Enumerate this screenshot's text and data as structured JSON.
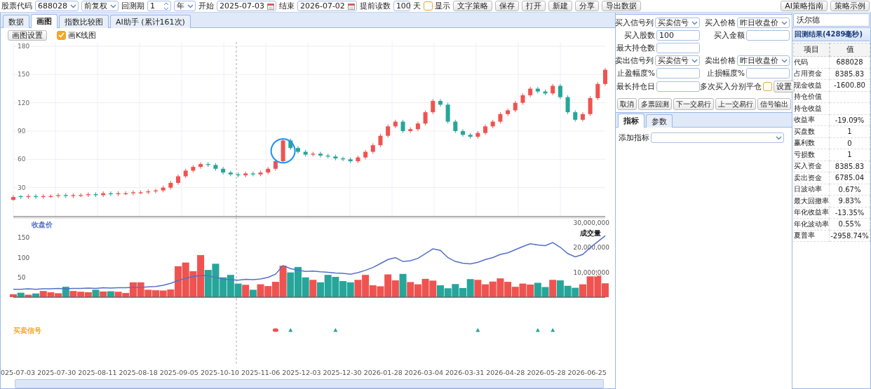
{
  "toolbar": {
    "items": [
      {
        "kind": "label",
        "text": "股票代码"
      },
      {
        "kind": "select",
        "value": "688028"
      },
      {
        "kind": "select",
        "value": "前复权"
      },
      {
        "kind": "label",
        "text": "回测期"
      },
      {
        "kind": "spinner",
        "value": "1"
      },
      {
        "kind": "select",
        "value": "年"
      },
      {
        "kind": "label",
        "text": "开始"
      },
      {
        "kind": "date",
        "value": "2025-07-03"
      },
      {
        "kind": "label",
        "text": "结束"
      },
      {
        "kind": "date",
        "value": "2026-07-02"
      },
      {
        "kind": "label",
        "text": "提前读数"
      },
      {
        "kind": "input",
        "value": "100"
      },
      {
        "kind": "label",
        "text": "天"
      },
      {
        "kind": "checkbox",
        "label": "显示",
        "checked": false
      },
      {
        "kind": "button",
        "label": "文字策略"
      },
      {
        "kind": "button",
        "label": "保存"
      },
      {
        "kind": "button",
        "label": "打开"
      },
      {
        "kind": "button",
        "label": "新建"
      },
      {
        "kind": "button",
        "label": "分享"
      },
      {
        "kind": "button",
        "label": "导出数据"
      }
    ],
    "right_buttons": [
      "AI策略指南",
      "策略示例"
    ]
  },
  "left": {
    "tabs": [
      {
        "label": "数据",
        "selected": false
      },
      {
        "label": "画图",
        "selected": true
      },
      {
        "label": "指数比较图",
        "selected": false
      },
      {
        "label": "AI助手 (累计161次)",
        "selected": false
      }
    ],
    "settings_button": "画图设置",
    "kline_checkbox": {
      "label": "画K线图",
      "checked": true
    },
    "price_chart": {
      "chart_data": {
        "type": "candlestick",
        "grid": true,
        "ylim": [
          0,
          180
        ],
        "yticks": [
          30,
          60,
          90,
          120,
          150,
          180
        ],
        "categories": [
          null,
          null,
          null,
          null,
          null,
          null,
          null,
          null,
          null,
          null,
          null,
          null,
          null,
          null,
          null,
          null,
          null,
          null,
          null,
          null,
          null,
          null,
          null,
          null,
          null,
          null,
          null,
          null,
          null,
          null,
          null,
          null,
          null,
          null,
          null,
          null,
          null,
          null,
          null,
          null,
          null,
          null,
          null,
          null,
          null,
          null,
          null,
          null,
          null,
          null,
          null,
          null,
          null,
          null,
          null,
          null,
          null,
          null,
          null,
          null,
          null,
          null,
          null,
          null,
          null,
          null,
          null,
          null,
          null,
          null,
          null,
          null,
          null,
          null,
          null,
          null,
          null,
          null,
          null,
          null
        ],
        "ohlc": [
          [
            17,
            22,
            16,
            20
          ],
          [
            21,
            22,
            18,
            20
          ],
          [
            20,
            23,
            18,
            21
          ],
          [
            21,
            23,
            18,
            20
          ],
          [
            20,
            23,
            18,
            21
          ],
          [
            20,
            23,
            19,
            21
          ],
          [
            21,
            24,
            19,
            22
          ],
          [
            22,
            24,
            19,
            21
          ],
          [
            21,
            24,
            19,
            22
          ],
          [
            21,
            24,
            20,
            22
          ],
          [
            22,
            25,
            20,
            23
          ],
          [
            23,
            25,
            20,
            22
          ],
          [
            22,
            26,
            20,
            24
          ],
          [
            24,
            26,
            21,
            23
          ],
          [
            23,
            26,
            21,
            24
          ],
          [
            23,
            26,
            22,
            24
          ],
          [
            24,
            27,
            22,
            25
          ],
          [
            24,
            27,
            23,
            25
          ],
          [
            25,
            28,
            23,
            26
          ],
          [
            26,
            29,
            24,
            27
          ],
          [
            27,
            32,
            25,
            30
          ],
          [
            30,
            37,
            28,
            35
          ],
          [
            35,
            44,
            33,
            42
          ],
          [
            42,
            50,
            40,
            48
          ],
          [
            48,
            54,
            46,
            52
          ],
          [
            52,
            57,
            50,
            55
          ],
          [
            55,
            57,
            52,
            54
          ],
          [
            54,
            56,
            48,
            50
          ],
          [
            50,
            52,
            44,
            46
          ],
          [
            46,
            48,
            42,
            44
          ],
          [
            44,
            46,
            41,
            43
          ],
          [
            43,
            47,
            41,
            45
          ],
          [
            45,
            47,
            42,
            44
          ],
          [
            44,
            48,
            42,
            46
          ],
          [
            46,
            52,
            44,
            50
          ],
          [
            50,
            60,
            48,
            58
          ],
          [
            58,
            82,
            56,
            80
          ],
          [
            80,
            82,
            70,
            72
          ],
          [
            72,
            74,
            66,
            68
          ],
          [
            68,
            70,
            63,
            65
          ],
          [
            65,
            68,
            63,
            66
          ],
          [
            66,
            68,
            62,
            64
          ],
          [
            64,
            66,
            61,
            63
          ],
          [
            63,
            65,
            59,
            61
          ],
          [
            61,
            63,
            58,
            60
          ],
          [
            60,
            62,
            56,
            58
          ],
          [
            58,
            64,
            56,
            62
          ],
          [
            62,
            70,
            60,
            68
          ],
          [
            68,
            77,
            66,
            75
          ],
          [
            75,
            87,
            73,
            85
          ],
          [
            85,
            97,
            83,
            95
          ],
          [
            95,
            102,
            93,
            100
          ],
          [
            100,
            102,
            88,
            90
          ],
          [
            90,
            94,
            88,
            92
          ],
          [
            92,
            100,
            90,
            98
          ],
          [
            98,
            112,
            96,
            110
          ],
          [
            110,
            124,
            108,
            122
          ],
          [
            122,
            124,
            116,
            118
          ],
          [
            118,
            120,
            98,
            100
          ],
          [
            100,
            102,
            88,
            90
          ],
          [
            90,
            92,
            84,
            86
          ],
          [
            86,
            88,
            82,
            84
          ],
          [
            84,
            90,
            82,
            88
          ],
          [
            88,
            97,
            86,
            95
          ],
          [
            95,
            102,
            93,
            100
          ],
          [
            100,
            110,
            98,
            108
          ],
          [
            108,
            114,
            106,
            112
          ],
          [
            112,
            122,
            110,
            120
          ],
          [
            120,
            130,
            118,
            128
          ],
          [
            128,
            137,
            126,
            135
          ],
          [
            135,
            137,
            130,
            132
          ],
          [
            132,
            134,
            128,
            130
          ],
          [
            130,
            140,
            128,
            138
          ],
          [
            138,
            140,
            124,
            126
          ],
          [
            126,
            128,
            108,
            110
          ],
          [
            110,
            112,
            100,
            102
          ],
          [
            102,
            110,
            100,
            108
          ],
          [
            108,
            127,
            106,
            125
          ],
          [
            125,
            142,
            123,
            140
          ],
          [
            140,
            157,
            138,
            155
          ]
        ]
      }
    },
    "volume_chart": {
      "chart_data": {
        "type": "bar",
        "ylim": [
          0,
          30000000
        ],
        "yticks": [
          {
            "value": 10000000,
            "label": "10,000,000"
          },
          {
            "value": 20000000,
            "label": "20,000,000"
          },
          {
            "value": 30000000,
            "label": "30,000,000"
          }
        ],
        "series": [
          {
            "name": "成交量",
            "values": [
              1200000,
              1800000,
              1000000,
              1500000,
              2500000,
              2000000,
              1600000,
              4200000,
              2500000,
              2200000,
              2000000,
              3000000,
              2300000,
              2400000,
              2200000,
              1700000,
              6000000,
              6000000,
              3000000,
              2800000,
              2700000,
              3100000,
              12500000,
              14000000,
              10500000,
              17000000,
              11000000,
              13500000,
              8000000,
              9000000,
              5500000,
              5000000,
              3000000,
              5200000,
              4500000,
              6200000,
              12700000,
              10000000,
              12200000,
              8000000,
              7000000,
              6000000,
              9000000,
              8200000,
              6500000,
              6000000,
              7000000,
              9000000,
              4800000,
              4400000,
              9200000,
              6800000,
              9400000,
              6100000,
              5200000,
              7400000,
              6700000,
              4800000,
              3600000,
              5300000,
              3700000,
              7300000,
              7000000,
              5200000,
              6300000,
              7600000,
              6200000,
              4200000,
              5500000,
              5100000,
              5800000,
              4100000,
              7000000,
              6800000,
              4600000,
              3800000,
              5200000,
              8400000,
              10800000,
              5600000
            ]
          }
        ]
      }
    },
    "close_chart": {
      "chart_data": {
        "type": "line",
        "ylim": [
          0,
          200
        ],
        "yticks": [
          50,
          100,
          150
        ],
        "series": [
          {
            "name": "收盘价",
            "color": "#5470c6",
            "values": [
              20,
              20,
              21,
              20,
              21,
              21,
              22,
              21,
              22,
              22,
              23,
              22,
              24,
              23,
              24,
              24,
              25,
              25,
              26,
              27,
              30,
              35,
              42,
              48,
              52,
              55,
              54,
              50,
              46,
              44,
              43,
              45,
              44,
              46,
              50,
              58,
              80,
              72,
              68,
              65,
              66,
              64,
              63,
              61,
              60,
              58,
              62,
              68,
              75,
              85,
              95,
              100,
              90,
              92,
              98,
              110,
              122,
              118,
              100,
              90,
              86,
              84,
              88,
              95,
              100,
              108,
              112,
              120,
              128,
              135,
              132,
              130,
              138,
              126,
              110,
              102,
              108,
              125,
              140,
              155
            ]
          }
        ]
      }
    },
    "signal_track": {
      "title": "买卖信号",
      "slots": [
        {
          "kind": "none"
        },
        {
          "kind": "none"
        },
        {
          "kind": "none"
        },
        {
          "kind": "none"
        },
        {
          "kind": "none"
        },
        {
          "kind": "none"
        },
        {
          "kind": "none"
        },
        {
          "kind": "none"
        },
        {
          "kind": "none"
        },
        {
          "kind": "none"
        },
        {
          "kind": "none"
        },
        {
          "kind": "none"
        },
        {
          "kind": "none"
        },
        {
          "kind": "none"
        },
        {
          "kind": "none"
        },
        {
          "kind": "none"
        },
        {
          "kind": "none"
        },
        {
          "kind": "none"
        },
        {
          "kind": "none"
        },
        {
          "kind": "none"
        },
        {
          "kind": "none"
        },
        {
          "kind": "none"
        },
        {
          "kind": "none"
        },
        {
          "kind": "none"
        },
        {
          "kind": "none"
        },
        {
          "kind": "none"
        },
        {
          "kind": "none"
        },
        {
          "kind": "none"
        },
        {
          "kind": "none"
        },
        {
          "kind": "none"
        },
        {
          "kind": "none"
        },
        {
          "kind": "none"
        },
        {
          "kind": "none"
        },
        {
          "kind": "none"
        },
        {
          "kind": "none"
        },
        {
          "kind": "sell"
        },
        {
          "kind": "none"
        },
        {
          "kind": "buy"
        },
        {
          "kind": "none"
        },
        {
          "kind": "none"
        },
        {
          "kind": "none"
        },
        {
          "kind": "none"
        },
        {
          "kind": "none"
        },
        {
          "kind": "buy"
        },
        {
          "kind": "none"
        },
        {
          "kind": "none"
        },
        {
          "kind": "none"
        },
        {
          "kind": "none"
        },
        {
          "kind": "none"
        },
        {
          "kind": "none"
        },
        {
          "kind": "none"
        },
        {
          "kind": "none"
        },
        {
          "kind": "none"
        },
        {
          "kind": "none"
        },
        {
          "kind": "none"
        },
        {
          "kind": "none"
        },
        {
          "kind": "none"
        },
        {
          "kind": "none"
        },
        {
          "kind": "none"
        },
        {
          "kind": "none"
        },
        {
          "kind": "none"
        },
        {
          "kind": "none"
        },
        {
          "kind": "buy"
        },
        {
          "kind": "none"
        },
        {
          "kind": "none"
        },
        {
          "kind": "none"
        },
        {
          "kind": "none"
        },
        {
          "kind": "none"
        },
        {
          "kind": "none"
        },
        {
          "kind": "none"
        },
        {
          "kind": "buy"
        },
        {
          "kind": "none"
        },
        {
          "kind": "buy"
        },
        {
          "kind": "none"
        },
        {
          "kind": "none"
        },
        {
          "kind": "none"
        },
        {
          "kind": "none"
        },
        {
          "kind": "none"
        },
        {
          "kind": "none"
        },
        {
          "kind": "none"
        }
      ]
    },
    "x_axis_labels": [
      "025-07-03",
      "2025-07-30",
      "2025-08-11",
      "2025-08-18",
      "2025-09-05",
      "2025-10-10",
      "2025-11-06",
      "2025-12-03",
      "2025-12-30",
      "2026-01-28",
      "2026-03-04",
      "2026-03-31",
      "2026-04-28",
      "2026-05-28",
      "2026-06-25"
    ]
  },
  "middle": {
    "form_rows": [
      [
        {
          "label": "买入信号列",
          "kind": "select",
          "value": "买卖信号"
        },
        {
          "label": "买入价格",
          "kind": "select",
          "value": "昨日收盘价"
        }
      ],
      [
        {
          "label": "买入股数",
          "kind": "input",
          "value": "100"
        },
        {
          "label": "买入金额",
          "kind": "input"
        }
      ],
      [
        {
          "label": "最大持仓数",
          "kind": "input"
        }
      ],
      [
        {
          "label": "卖出信号列",
          "kind": "select",
          "value": "买卖信号"
        },
        {
          "label": "卖出价格",
          "kind": "select",
          "value": "昨日收盘价"
        }
      ],
      [
        {
          "label": "止盈幅度%",
          "kind": "input"
        },
        {
          "label": "止损幅度%",
          "kind": "input"
        }
      ],
      [
        {
          "label": "最长持仓日",
          "kind": "input"
        },
        {
          "label": "多次买入分别平仓",
          "kind": "checkbox",
          "checked": false,
          "button": "设置"
        }
      ]
    ],
    "buttons": [
      "取消",
      "多票回测",
      "下一交易行",
      "上一交易行",
      "信号输出"
    ],
    "tabs": [
      {
        "label": "指标",
        "selected": true
      },
      {
        "label": "参数",
        "selected": false
      }
    ],
    "indicator_label": "添加指标"
  },
  "right": {
    "stock_name": "沃尔德",
    "results_title": "回测结果(4289毫秒)",
    "columns": [
      "项目",
      "值"
    ],
    "rows": [
      [
        "代码",
        "688028"
      ],
      [
        "占用资金",
        "8385.83"
      ],
      [
        "现金收益",
        "-1600.80"
      ],
      [
        "持仓价值",
        ""
      ],
      [
        "持仓收益",
        ""
      ],
      [
        "收益率",
        "-19.09%"
      ],
      [
        "买盘数",
        "1"
      ],
      [
        "赢利数",
        "0"
      ],
      [
        "亏损数",
        "1"
      ],
      [
        "买入资金",
        "8385.83"
      ],
      [
        "卖出资金",
        "6785.04"
      ],
      [
        "日波动率",
        "0.67%"
      ],
      [
        "最大回撤率",
        "9.83%"
      ],
      [
        "年化收益率",
        "-13.35%"
      ],
      [
        "年化波动率",
        "0.55%"
      ],
      [
        "夏普率",
        "-2958.74%"
      ]
    ]
  }
}
